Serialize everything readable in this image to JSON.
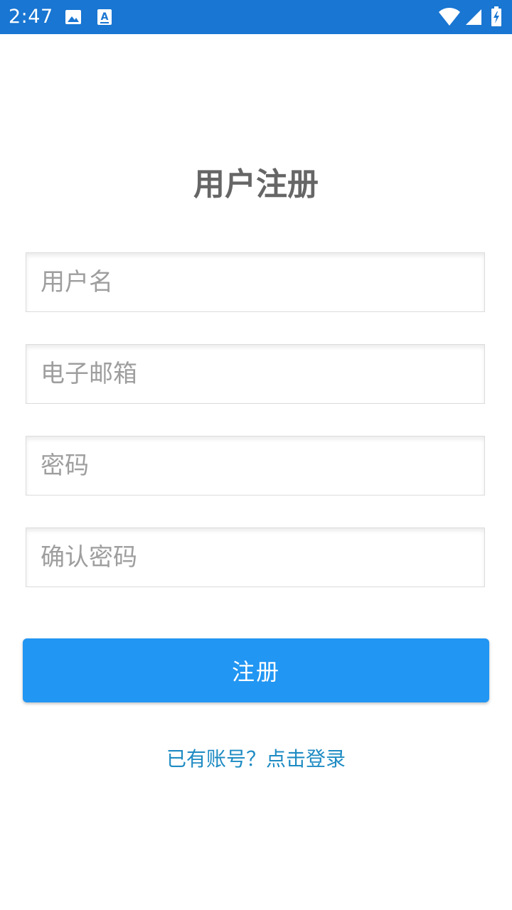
{
  "status_bar": {
    "time": "2:47",
    "color": "#1976d2",
    "icons": [
      "image-icon",
      "a-icon",
      "wifi-icon",
      "signal-icon",
      "battery-icon"
    ]
  },
  "form": {
    "title": "用户注册",
    "username_placeholder": "用户名",
    "email_placeholder": "电子邮箱",
    "password_placeholder": "密码",
    "confirm_password_placeholder": "确认密码",
    "submit_label": "注册",
    "login_link_text": "已有账号？点击登录"
  },
  "colors": {
    "accent": "#2196f3",
    "link": "#1e8bc3",
    "title_text": "#666666"
  }
}
